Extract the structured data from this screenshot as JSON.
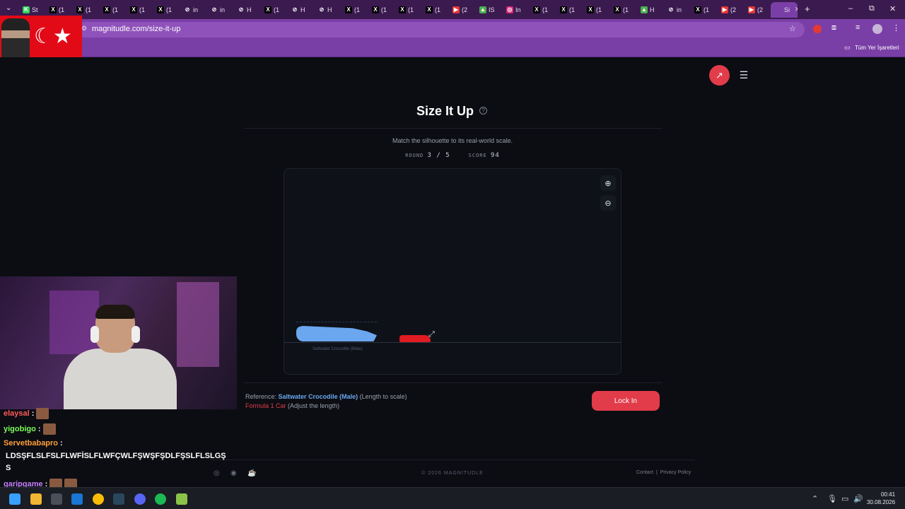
{
  "browser": {
    "tabs": [
      {
        "label": "St",
        "icon": "K",
        "color": "#2dd45a"
      },
      {
        "label": "(1",
        "icon": "X",
        "color": "#000000"
      },
      {
        "label": "(1",
        "icon": "X",
        "color": "#000000"
      },
      {
        "label": "(1",
        "icon": "X",
        "color": "#000000"
      },
      {
        "label": "(1",
        "icon": "X",
        "color": "#000000"
      },
      {
        "label": "(1",
        "icon": "X",
        "color": "#000000"
      },
      {
        "label": "in",
        "icon": "⊘",
        "color": "#3b1a4f"
      },
      {
        "label": "in",
        "icon": "⊘",
        "color": "#3b1a4f"
      },
      {
        "label": "H",
        "icon": "⊘",
        "color": "#3b1a4f"
      },
      {
        "label": "(1",
        "icon": "X",
        "color": "#000000"
      },
      {
        "label": "H",
        "icon": "⊘",
        "color": "#3b1a4f"
      },
      {
        "label": "H",
        "icon": "⊘",
        "color": "#3b1a4f"
      },
      {
        "label": "(1",
        "icon": "X",
        "color": "#000000"
      },
      {
        "label": "(1",
        "icon": "X",
        "color": "#000000"
      },
      {
        "label": "(1",
        "icon": "X",
        "color": "#000000"
      },
      {
        "label": "(1",
        "icon": "X",
        "color": "#000000"
      },
      {
        "label": "(2",
        "icon": "▶",
        "color": "#e53935"
      },
      {
        "label": "IS",
        "icon": "▲",
        "color": "#4caf50"
      },
      {
        "label": "In",
        "icon": "◎",
        "color": "#d62976"
      },
      {
        "label": "(1",
        "icon": "X",
        "color": "#000000"
      },
      {
        "label": "(1",
        "icon": "X",
        "color": "#000000"
      },
      {
        "label": "(1",
        "icon": "X",
        "color": "#000000"
      },
      {
        "label": "(1",
        "icon": "X",
        "color": "#000000"
      },
      {
        "label": "H",
        "icon": "▲",
        "color": "#4caf50"
      },
      {
        "label": "in",
        "icon": "⊘",
        "color": "#3b1a4f"
      },
      {
        "label": "(1",
        "icon": "X",
        "color": "#000000"
      },
      {
        "label": "(2",
        "icon": "▶",
        "color": "#e53935"
      },
      {
        "label": "(2",
        "icon": "▶",
        "color": "#e53935"
      },
      {
        "label": "Si",
        "icon": "",
        "color": "#7a3fa6"
      }
    ],
    "url": "magnitudle.com/size-it-up",
    "bookmarks_label": "Tüm Yer İşaretleri"
  },
  "page": {
    "title": "Size It Up",
    "subtitle": "Match the silhouette to its real-world scale.",
    "round_label": "ROUND",
    "round_value": "3 / 5",
    "score_label": "SCORE",
    "score_value": "94",
    "reference_prefix": "Reference:",
    "reference_name": "Saltwater Crocodile (Male)",
    "reference_suffix": "(Length to scale)",
    "target_name": "Formula 1 Car",
    "target_suffix": "(Adjust the length)",
    "canvas_label": "Saltwater Crocodile (Male)",
    "lock_in": "Lock In",
    "copyright": "© 2026 MAGNITUDLE",
    "contact": "Contact",
    "separator": "|",
    "privacy": "Privacy Policy",
    "colors": {
      "accent": "#e23b4a",
      "reference": "#6aa7ef",
      "target": "#e01b22"
    }
  },
  "chat": [
    {
      "user": "elaysal",
      "sep": ":",
      "message": "",
      "emotes": 1,
      "color": "#ff5a5a"
    },
    {
      "user": "yigobigo",
      "sep": ":",
      "message": "",
      "emotes": 1,
      "color": "#7cfc5a"
    },
    {
      "user": "Servetbabapro",
      "sep": ":",
      "message": "",
      "emotes": 0,
      "color": "#ff9f3a"
    },
    {
      "user": "",
      "sep": "",
      "message": "LDSŞFLSLFSLFLWFİSLFLWFÇWLFŞWŞFŞDLFŞSLFLSLGŞ",
      "emotes": 0,
      "color": "#ffffff"
    },
    {
      "user": "",
      "sep": "",
      "message": "S",
      "emotes": 0,
      "color": "#ffffff"
    },
    {
      "user": "garipgame",
      "sep": ":",
      "message": "",
      "emotes": 2,
      "color": "#c77dff"
    }
  ],
  "taskbar": {
    "time": "00:41",
    "date": "30.08.2026"
  }
}
